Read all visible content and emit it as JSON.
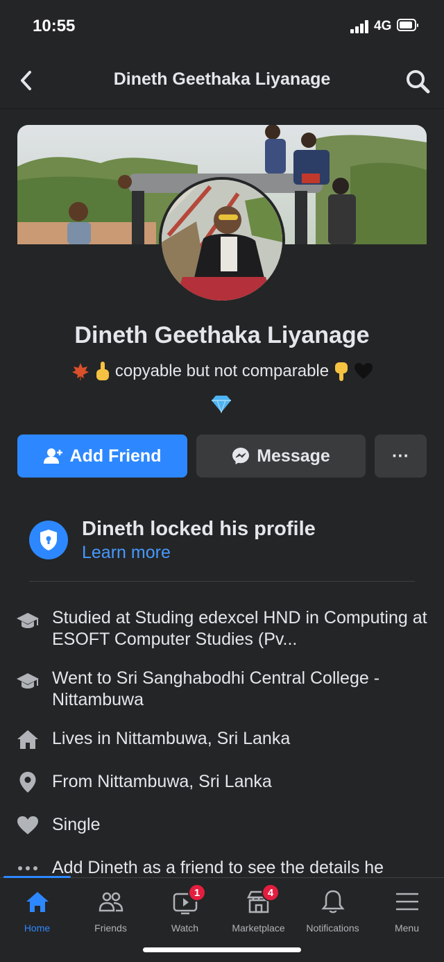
{
  "status_bar": {
    "time": "10:55",
    "network": "4G"
  },
  "navbar": {
    "title": "Dineth Geethaka Liyanage"
  },
  "profile": {
    "name": "Dineth Geethaka Liyanage",
    "bio": "copyable but not comparable",
    "bio_emojis_left": [
      "maple-leaf",
      "pointing-up-hand"
    ],
    "bio_emojis_right": [
      "pointing-down-hand",
      "black-heart"
    ],
    "bio_emoji_below": "gem"
  },
  "actions": {
    "add_friend": "Add Friend",
    "message": "Message",
    "more": "···"
  },
  "locked": {
    "title": "Dineth locked his profile",
    "link": "Learn more"
  },
  "info": [
    {
      "icon": "graduation-cap-icon",
      "prefix": "Studied at ",
      "highlight": "Studing edexcel HND in Computing at ESOFT Computer Studies (Pv..."
    },
    {
      "icon": "graduation-cap-icon",
      "prefix": "Went to ",
      "highlight": "Sri Sanghabodhi Central College - Nittambuwa"
    },
    {
      "icon": "house-icon",
      "prefix": "Lives in ",
      "highlight": "Nittambuwa, Sri Lanka"
    },
    {
      "icon": "location-pin-icon",
      "prefix": "From ",
      "highlight": "Nittambuwa, Sri Lanka"
    },
    {
      "icon": "heart-icon",
      "prefix": "",
      "highlight": "Single"
    },
    {
      "icon": "more-dots-icon",
      "prefix": "",
      "highlight": "Add Dineth as a friend to see the details he"
    }
  ],
  "tabs": [
    {
      "label": "Home",
      "active": true
    },
    {
      "label": "Friends"
    },
    {
      "label": "Watch",
      "badge": "1"
    },
    {
      "label": "Marketplace",
      "badge": "4"
    },
    {
      "label": "Notifications"
    },
    {
      "label": "Menu"
    }
  ],
  "colors": {
    "background": "#242526",
    "accent": "#2d88ff",
    "button_secondary": "#3a3b3c",
    "badge": "#e41e3f",
    "link": "#4599ff"
  }
}
